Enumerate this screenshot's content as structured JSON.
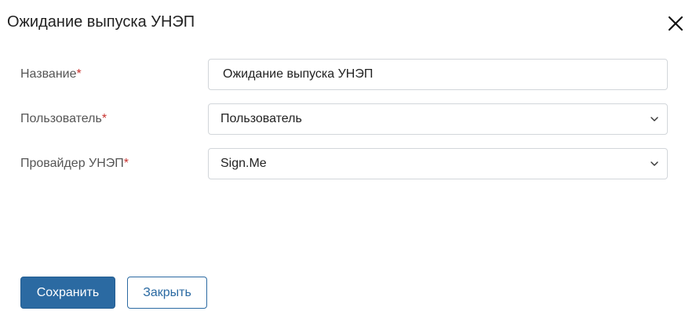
{
  "dialog": {
    "title": "Ожидание выпуска УНЭП",
    "close_icon": "close-icon"
  },
  "form": {
    "name": {
      "label": "Название",
      "required_mark": "*",
      "value": "Ожидание выпуска УНЭП"
    },
    "user": {
      "label": "Пользователь",
      "required_mark": "*",
      "selected": "Пользователь",
      "icon": "chevron-down-icon"
    },
    "provider": {
      "label": "Провайдер УНЭП",
      "required_mark": "*",
      "selected": "Sign.Me",
      "icon": "chevron-down-icon"
    }
  },
  "footer": {
    "save_label": "Сохранить",
    "close_label": "Закрыть"
  },
  "colors": {
    "primary": "#2b6aa2",
    "required": "#c8322f",
    "border": "#d2d6da"
  }
}
